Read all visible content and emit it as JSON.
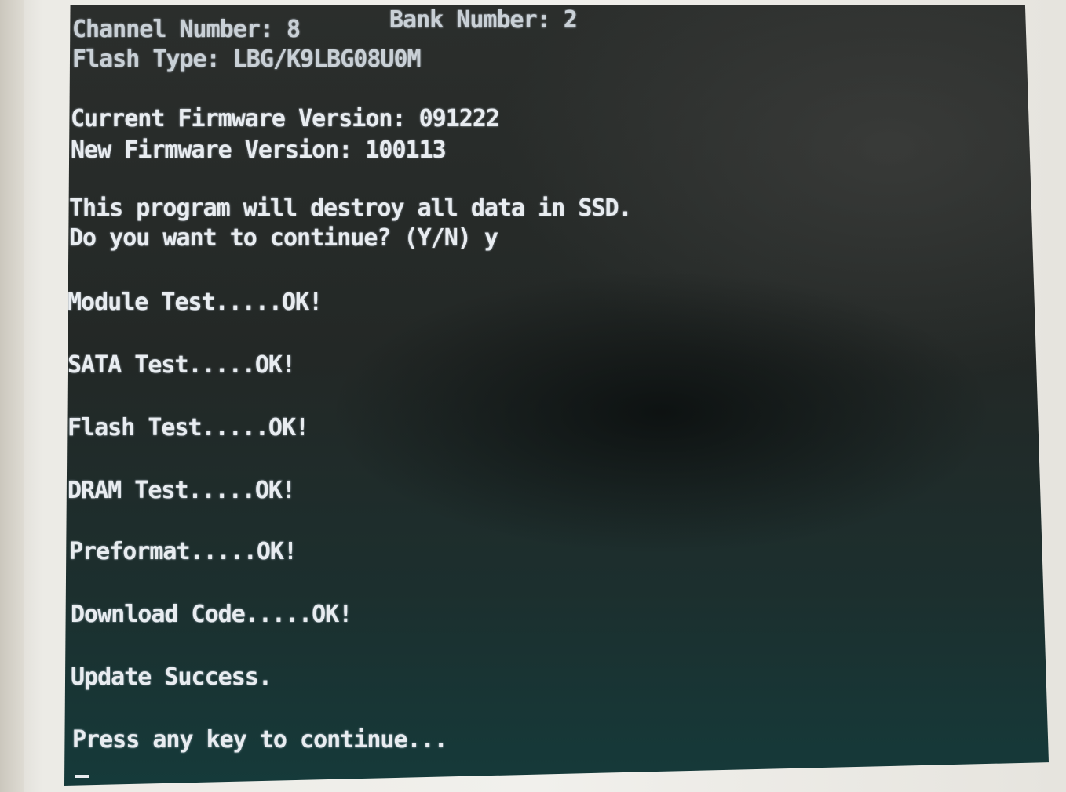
{
  "terminal": {
    "channel_number": "Channel Number: 8",
    "bank_number": "Bank Number: 2",
    "flash_type": "Flash Type: LBG/K9LBG08U0M",
    "current_fw": "Current Firmware Version: 091222",
    "new_fw": "New Firmware Version: 100113",
    "warning": "This program will destroy all data in SSD.",
    "prompt": "Do you want to continue? (Y/N) y",
    "module_test": "Module Test.....OK!",
    "sata_test": "SATA Test.....OK!",
    "flash_test": "Flash Test.....OK!",
    "dram_test": "DRAM Test.....OK!",
    "preformat": "Preformat.....OK!",
    "download_code": "Download Code.....OK!",
    "update_success": "Update Success.",
    "press_any_key": "Press any key to continue..."
  },
  "colors": {
    "text": "#e8ecf0",
    "screen_top": "#2b2e2c",
    "screen_bottom": "#153a3a",
    "bezel": "#ecebe6"
  }
}
